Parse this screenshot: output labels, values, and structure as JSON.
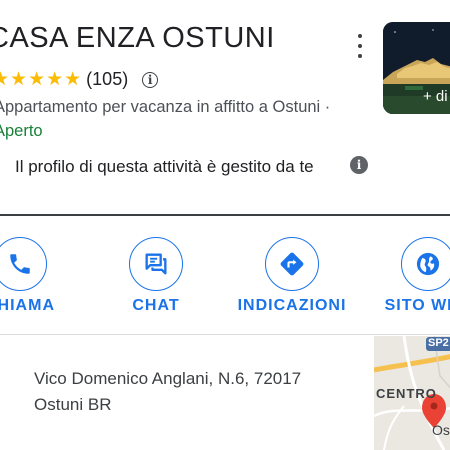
{
  "place": {
    "title": "CASA ENZA OSTUNI",
    "stars": "★★★★★",
    "rating_count": "(105)",
    "category": "Appartamento per vacanza in affitto a Ostuni ·",
    "status": "Aperto",
    "photo_label": "+ di"
  },
  "managed": {
    "text": "Il profilo di questa attività è gestito da te"
  },
  "actions": [
    {
      "label": "CHIAMA",
      "icon": "phone-icon"
    },
    {
      "label": "CHAT",
      "icon": "chat-icon"
    },
    {
      "label": "INDICAZIONI",
      "icon": "directions-icon"
    },
    {
      "label": "SITO WEB",
      "icon": "globe-icon"
    }
  ],
  "address": {
    "line1": "Vico Domenico Anglani, N.6, 72017",
    "line2": "Ostuni BR"
  },
  "map": {
    "road_badge": "SP2",
    "center_label": "CENTRO",
    "town_label": "Os"
  },
  "colors": {
    "accent": "#1a73e8",
    "star": "#fbbc04",
    "open": "#188038",
    "pin": "#ea4335"
  }
}
